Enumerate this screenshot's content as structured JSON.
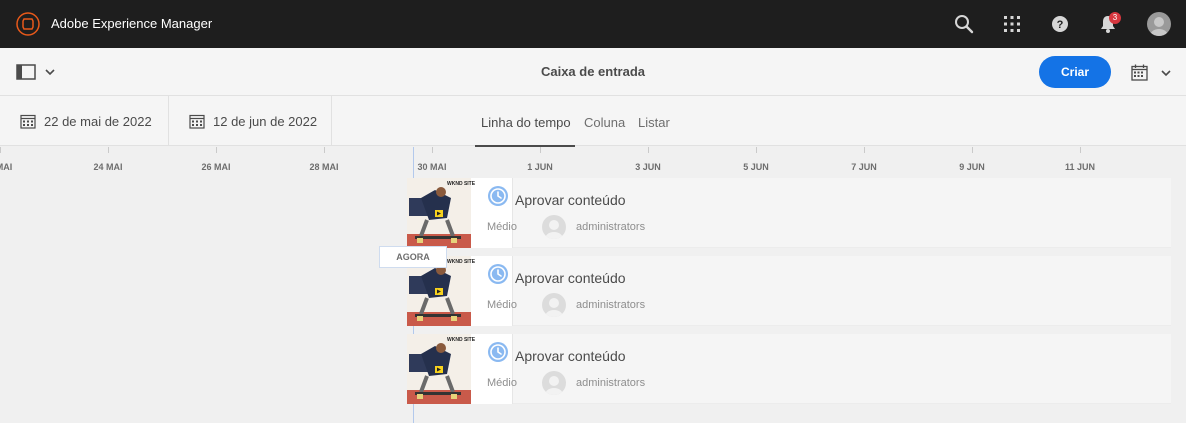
{
  "app": {
    "title": "Adobe Experience Manager"
  },
  "header": {
    "notification_count": "3",
    "icons": [
      "search-icon",
      "apps-icon",
      "help-icon",
      "bell-icon",
      "user-avatar"
    ]
  },
  "actionbar": {
    "page_title": "Caixa de entrada",
    "create_label": "Criar"
  },
  "filters": {
    "start_date": "22 de mai de 2022",
    "end_date": "12 de jun de 2022"
  },
  "views": {
    "tabs": [
      "Linha do tempo",
      "Coluna",
      "Listar"
    ],
    "active": "Linha do tempo"
  },
  "timeline": {
    "ticks": [
      "MAI",
      "24 MAI",
      "26 MAI",
      "28 MAI",
      "30 MAI",
      "1 JUN",
      "3 JUN",
      "5 JUN",
      "7 JUN",
      "9 JUN",
      "11 JUN"
    ],
    "now_label": "AGORA"
  },
  "tasks": [
    {
      "title": "Aprovar conteúdo",
      "priority": "Médio",
      "assignee": "administrators",
      "thumb_caption": "WKND SITE"
    },
    {
      "title": "Aprovar conteúdo",
      "priority": "Médio",
      "assignee": "administrators",
      "thumb_caption": "WKND SITE"
    },
    {
      "title": "Aprovar conteúdo",
      "priority": "Médio",
      "assignee": "administrators",
      "thumb_caption": "WKND SITE"
    }
  ],
  "colors": {
    "topbar": "#1e1e1e",
    "accent": "#1473e6",
    "badge": "#d7373f",
    "clock": "#8ab9f1"
  }
}
